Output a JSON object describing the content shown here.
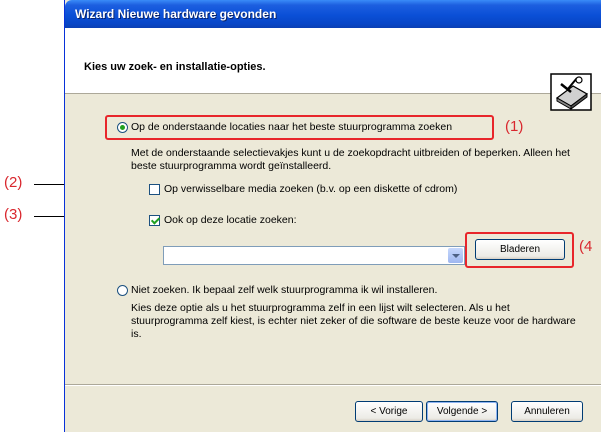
{
  "window": {
    "title": "Wizard Nieuwe hardware gevonden"
  },
  "header": {
    "heading": "Kies uw zoek- en installatie-opties.",
    "icon": "hardware-wizard-icon"
  },
  "option_search": {
    "label": "Op de onderstaande locaties naar het beste stuurprogramma zoeken",
    "selected": true,
    "description": "Met de onderstaande selectievakjes kunt u de zoekopdracht uitbreiden of beperken. Alleen het beste stuurprogramma wordt geïnstalleerd."
  },
  "check_media": {
    "label": "Op verwisselbare media zoeken (b.v. op een diskette of cdrom)",
    "checked": false
  },
  "check_location": {
    "label": "Ook op deze locatie zoeken:",
    "checked": true
  },
  "location_combo": {
    "value": ""
  },
  "browse_button": {
    "label": "Bladeren"
  },
  "option_nosearch": {
    "label": "Niet zoeken. Ik bepaal zelf welk stuurprogramma ik wil installeren.",
    "selected": false,
    "description": "Kies deze optie als u het stuurprogramma zelf in een lijst wilt selecteren. Als u het stuurprogramma zelf kiest, is echter niet zeker of die software de beste keuze voor de hardware is."
  },
  "footer": {
    "back_label": "< Vorige",
    "next_label": "Volgende >",
    "cancel_label": "Annuleren"
  },
  "callouts": {
    "c1": "(1)",
    "c2": "(2)",
    "c3": "(3)",
    "c4": "(4"
  },
  "colors": {
    "annotation": "#e8262b",
    "title_bar": "#0a4fd6",
    "dialog_face": "#ece9d8"
  }
}
